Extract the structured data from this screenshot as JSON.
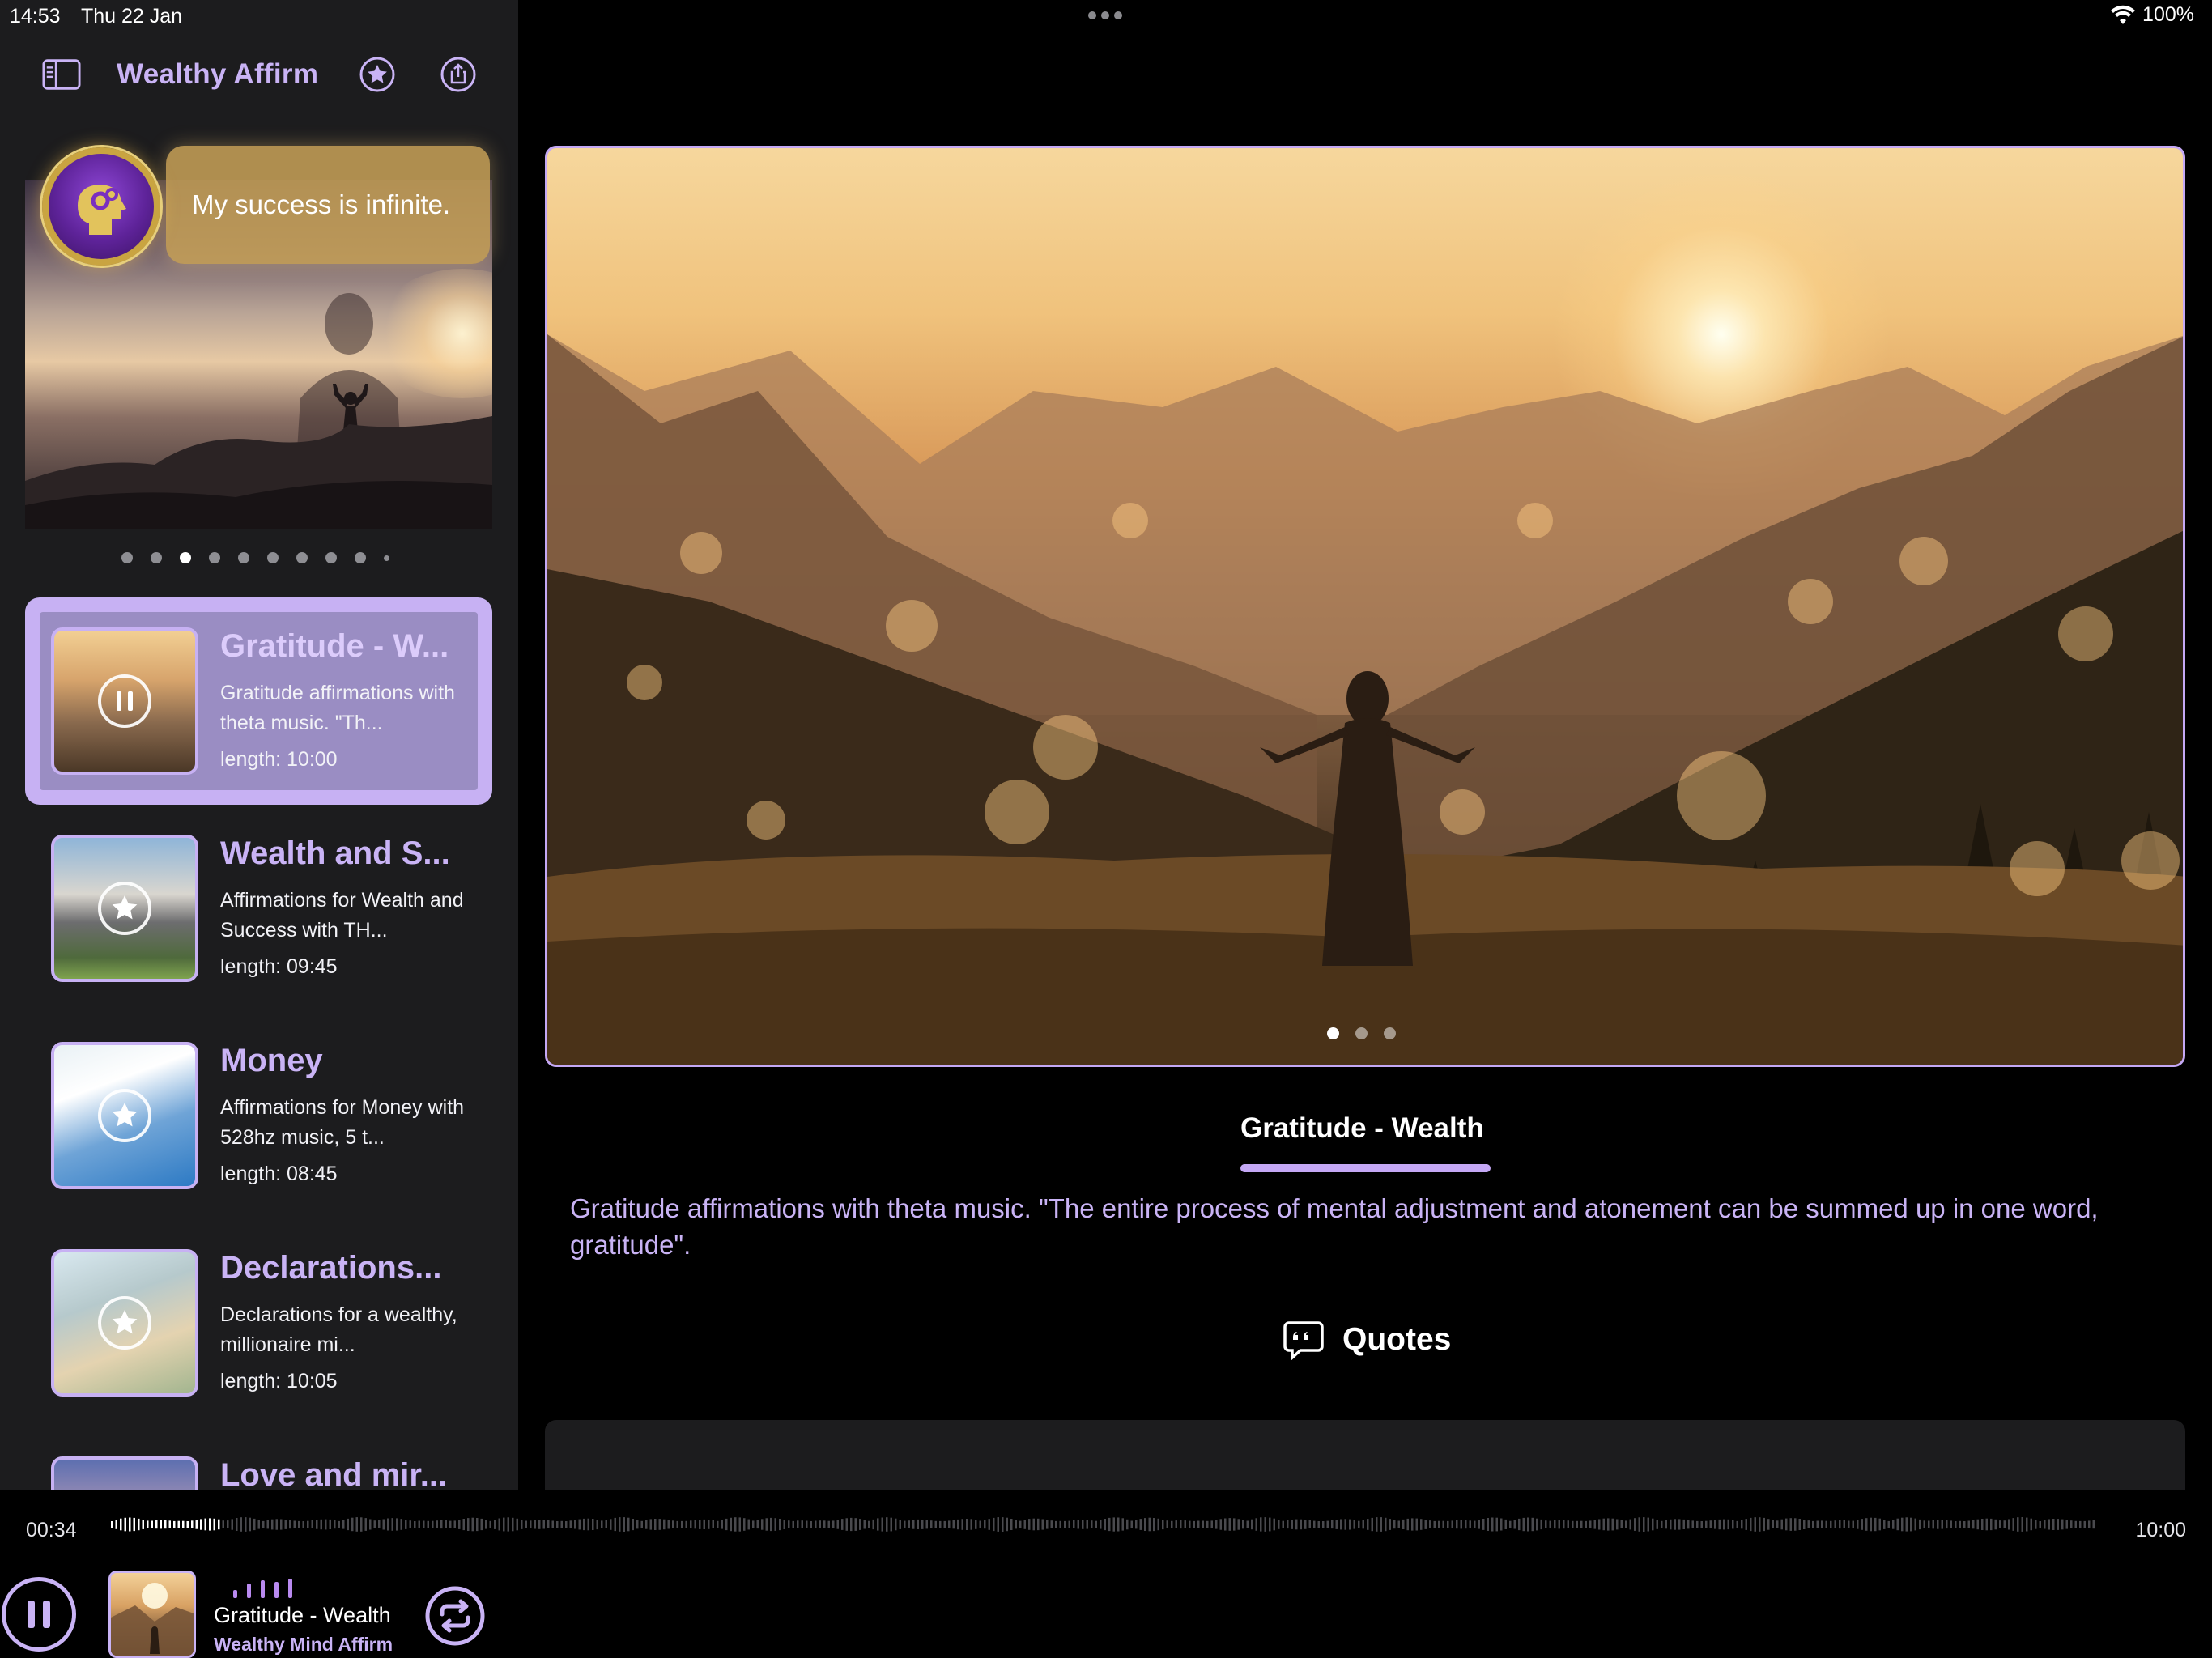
{
  "status_bar": {
    "time": "14:53",
    "date": "Thu 22 Jan",
    "battery": "100%",
    "icons": [
      "multitask-dots-icon",
      "wifi-icon"
    ]
  },
  "sidebar": {
    "title": "Wealthy Affirm",
    "header_icons": [
      "sidebar-toggle-icon",
      "star-icon",
      "share-icon"
    ],
    "hero": {
      "affirmation": "My success is infinite.",
      "badge_icon": "mind-gears-icon"
    },
    "hero_pages": {
      "count": 10,
      "active_index": 2
    },
    "tracks": [
      {
        "title": "Gratitude - W...",
        "description": "Gratitude affirmations with theta music. \"Th...",
        "length": "length: 10:00",
        "selected": true,
        "overlay_icon": "pause-icon"
      },
      {
        "title": "Wealth and S...",
        "description": "Affirmations for Wealth and Success with TH...",
        "length": "length: 09:45",
        "selected": false,
        "overlay_icon": "star-icon"
      },
      {
        "title": "Money",
        "description": "Affirmations for Money with 528hz music, 5 t...",
        "length": "length: 08:45",
        "selected": false,
        "overlay_icon": "star-icon"
      },
      {
        "title": "Declarations...",
        "description": "Declarations for a wealthy, millionaire mi...",
        "length": "length: 10:05",
        "selected": false,
        "overlay_icon": "star-icon"
      },
      {
        "title": "Love and mir...",
        "description": "",
        "length": "",
        "selected": false,
        "overlay_icon": ""
      }
    ]
  },
  "main": {
    "carousel": {
      "count": 3,
      "active_index": 0
    },
    "tab_title": "Gratitude - Wealth",
    "description": "Gratitude affirmations with theta music. \"The entire process of mental adjustment and atonement can be summed up in one word, gratitude\".",
    "quotes_label": "Quotes",
    "quotes_icon": "quote-bubble-icon"
  },
  "player": {
    "current_time": "00:34",
    "total_time": "10:00",
    "progress": 0.057,
    "title": "Gratitude - Wealth",
    "artist": "Wealthy Mind Affirm",
    "icons": [
      "pause-icon",
      "repeat-icon"
    ]
  },
  "colors": {
    "accent": "#c9b3f5",
    "accent_strong": "#c4a8f5",
    "selected_bg": "#9a8dc3",
    "sidebar_bg": "#1c1c1e",
    "background": "#000000"
  }
}
